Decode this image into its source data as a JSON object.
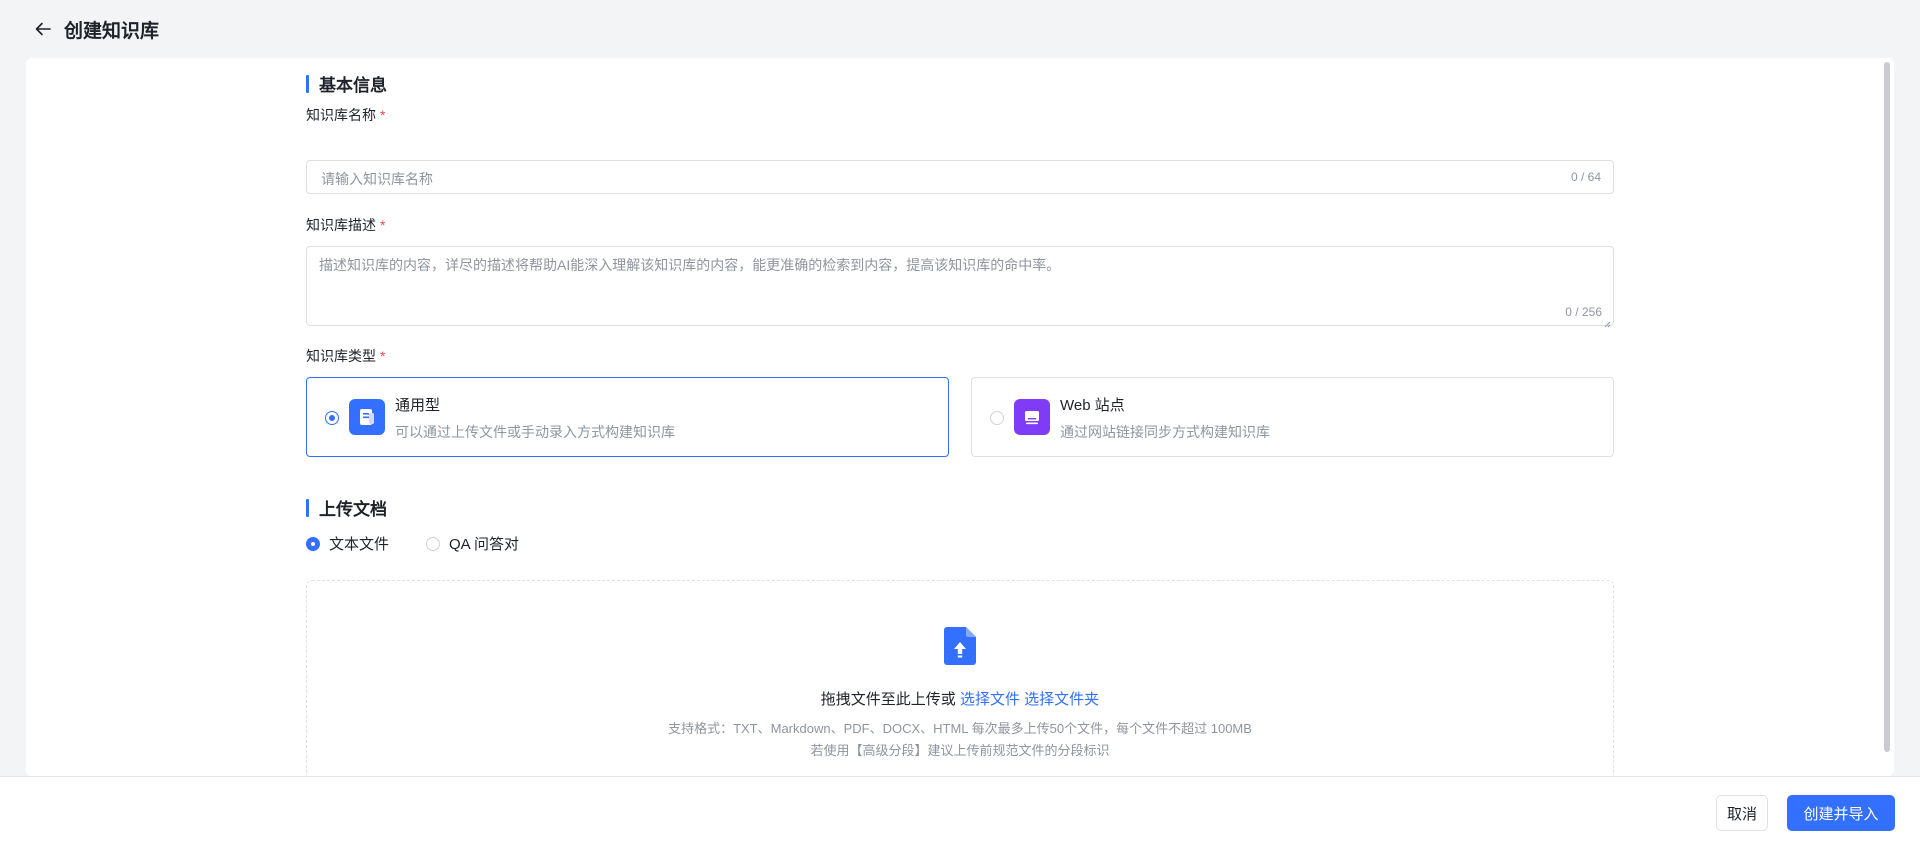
{
  "header": {
    "title": "创建知识库"
  },
  "basic_info": {
    "section_title": "基本信息",
    "name": {
      "label": "知识库名称",
      "required_mark": "*",
      "placeholder": "请输入知识库名称",
      "counter": "0 / 64"
    },
    "description": {
      "label": "知识库描述",
      "required_mark": "*",
      "placeholder": "描述知识库的内容，详尽的描述将帮助AI能深入理解该知识库的内容，能更准确的检索到内容，提高该知识库的命中率。",
      "counter": "0 / 256"
    },
    "type": {
      "label": "知识库类型",
      "required_mark": "*",
      "options": [
        {
          "name": "通用型",
          "desc": "可以通过上传文件或手动录入方式构建知识库",
          "selected": true,
          "icon": "document-icon",
          "icon_color": "#3370ff"
        },
        {
          "name": "Web 站点",
          "desc": "通过网站链接同步方式构建知识库",
          "selected": false,
          "icon": "monitor-icon",
          "icon_color": "#7f3bf5"
        }
      ]
    }
  },
  "upload": {
    "section_title": "上传文档",
    "modes": [
      {
        "label": "文本文件",
        "selected": true
      },
      {
        "label": "QA 问答对",
        "selected": false
      }
    ],
    "dropzone": {
      "icon": "file-upload-icon",
      "text": "拖拽文件至此上传或",
      "link_file": "选择文件",
      "link_folder": "选择文件夹",
      "hint1": "支持格式：TXT、Markdown、PDF、DOCX、HTML 每次最多上传50个文件，每个文件不超过 100MB",
      "hint2": "若使用【高级分段】建议上传前规范文件的分段标识"
    }
  },
  "footer": {
    "cancel_label": "取消",
    "submit_label": "创建并导入"
  },
  "colors": {
    "accent": "#3370ff",
    "web_icon": "#7f3bf5",
    "required": "#f54a45"
  }
}
